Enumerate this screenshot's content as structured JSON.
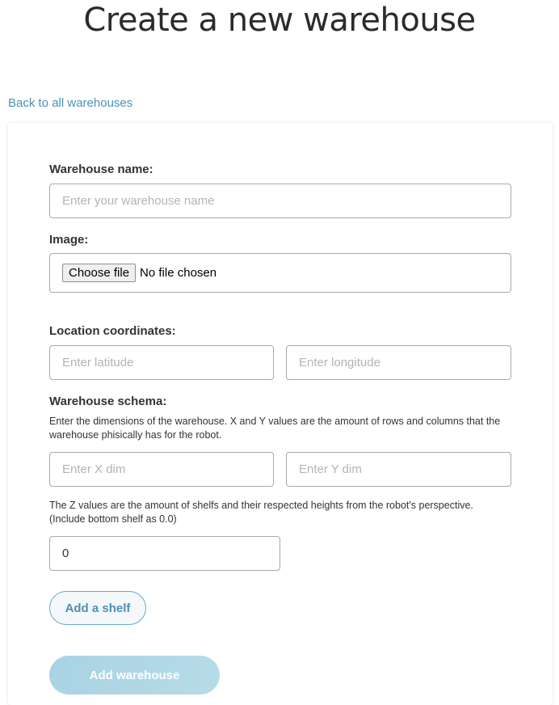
{
  "page": {
    "title": "Create a new warehouse",
    "back_link": "Back to all warehouses"
  },
  "form": {
    "name_label": "Warehouse name:",
    "name_placeholder": "Enter your warehouse name",
    "image_label": "Image:",
    "file_button": "Choose file",
    "file_status": "No file chosen",
    "location_label": "Location coordinates:",
    "latitude_placeholder": "Enter latitude",
    "longitude_placeholder": "Enter longitude",
    "schema_label": "Warehouse schema:",
    "schema_help": "Enter the dimensions of the warehouse. X and Y values are the amount of rows and columns that the warehouse phisically has for the robot.",
    "x_placeholder": "Enter X dim",
    "y_placeholder": "Enter Y dim",
    "z_help": "The Z values are the amount of shelfs and their respected heights from the robot's perspective. (Include bottom shelf as 0.0)",
    "z_value": "0",
    "add_shelf_button": "Add a shelf",
    "submit_button": "Add warehouse"
  },
  "colors": {
    "link": "#4a90b8",
    "submit_bg": "#b0d7e6",
    "border": "#a9a9a9"
  }
}
